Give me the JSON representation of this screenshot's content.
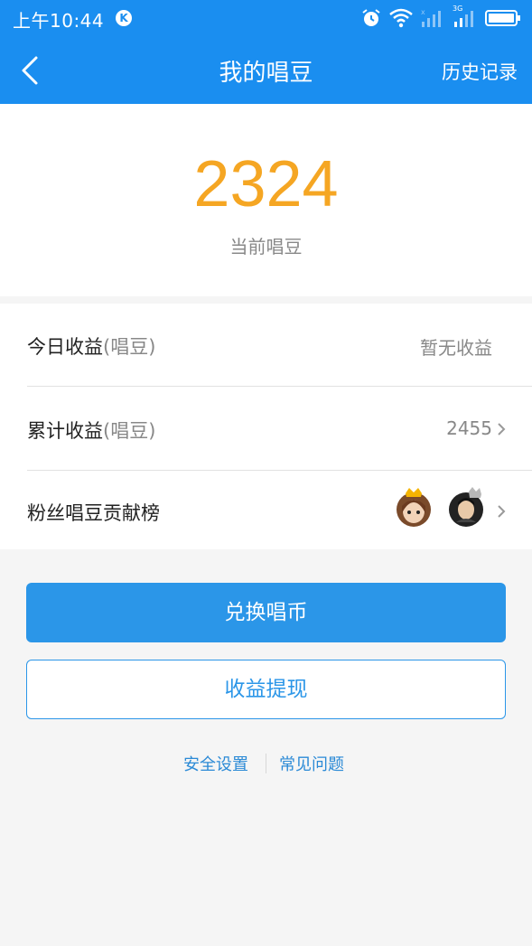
{
  "status_bar": {
    "time": "上午10:44",
    "badge": "K",
    "icons": [
      "alarm-icon",
      "wifi-icon",
      "signal-icon",
      "signal-3g-icon",
      "battery-icon"
    ],
    "network_label": "3G"
  },
  "nav": {
    "title": "我的唱豆",
    "right_action": "历史记录",
    "back_icon": "chevron-left-icon"
  },
  "balance": {
    "value": "2324",
    "label": "当前唱豆"
  },
  "rows": [
    {
      "label": "今日收益",
      "unit": "(唱豆)",
      "value": "暂无收益"
    },
    {
      "label": "累计收益",
      "unit": "(唱豆)",
      "value": "2455"
    },
    {
      "label": "粉丝唱豆贡献榜",
      "avatars": [
        "avatar-gold-crown",
        "avatar-silver-crown"
      ]
    }
  ],
  "buttons": {
    "exchange": "兑换唱币",
    "withdraw": "收益提现"
  },
  "links": {
    "security": "安全设置",
    "faq": "常见问题"
  },
  "colors": {
    "primary": "#1a8ef0",
    "button": "#2b96e8",
    "balance": "#f5a623",
    "background": "#f5f5f5"
  }
}
